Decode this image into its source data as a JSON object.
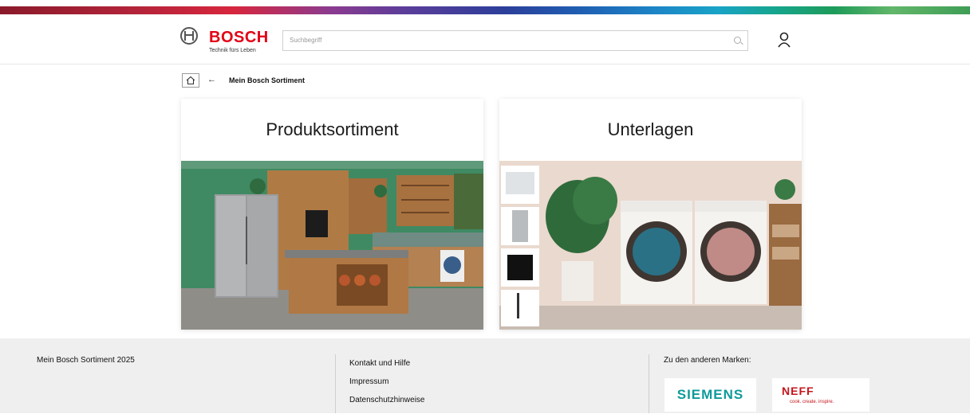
{
  "header": {
    "brand": "BOSCH",
    "tagline": "Technik fürs Leben",
    "search_placeholder": "Suchbegriff"
  },
  "breadcrumb": {
    "back_glyph": "←",
    "current": "Mein Bosch Sortiment"
  },
  "cards": [
    {
      "title": "Produktsortiment",
      "image": "kitchen-scene"
    },
    {
      "title": "Unterlagen",
      "image": "laundry-scene"
    }
  ],
  "footer": {
    "title": "Mein Bosch Sortiment 2025",
    "links": [
      "Kontakt und Hilfe",
      "Impressum",
      "Datenschutzhinweise"
    ],
    "brands_label": "Zu den anderen Marken:",
    "brands": {
      "siemens": "SIEMENS",
      "neff": "NEFF",
      "neff_tagline": "cook. create. inspire."
    }
  },
  "colors": {
    "brand_red": "#e20015",
    "siemens_teal": "#0f9a9a",
    "neff_red": "#c4161c",
    "footer_bg": "#efefef"
  },
  "icons": [
    "bosch-logo-icon",
    "search-icon",
    "user-icon",
    "home-icon",
    "back-arrow-icon"
  ]
}
